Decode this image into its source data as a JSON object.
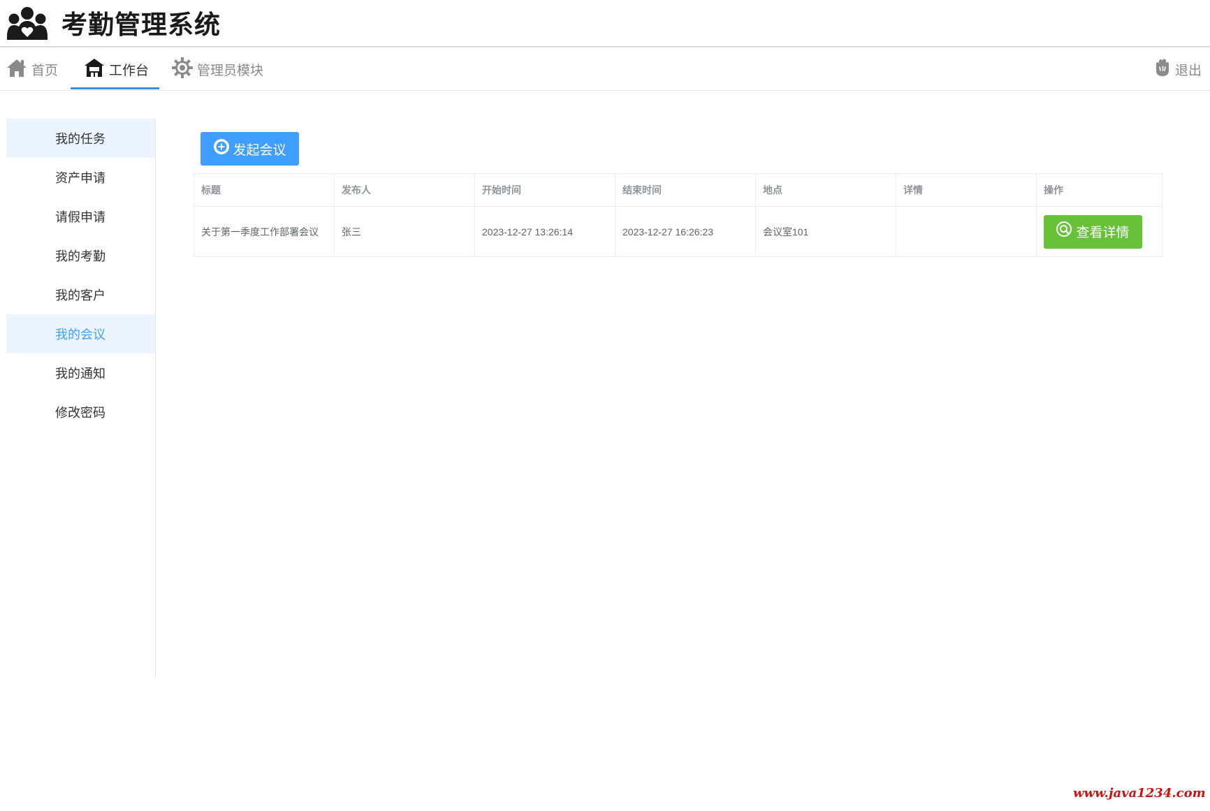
{
  "app": {
    "title": "考勤管理系统",
    "logo_icon": "users-heart-icon"
  },
  "top_nav": {
    "items": [
      {
        "label": "首页",
        "icon": "home-icon"
      },
      {
        "label": "工作台",
        "icon": "workbench-icon",
        "active": true
      },
      {
        "label": "管理员模块",
        "icon": "gear-icon"
      }
    ],
    "logout": {
      "label": "退出",
      "icon": "hand-icon"
    }
  },
  "sidebar": {
    "items": [
      {
        "label": "我的任务"
      },
      {
        "label": "资产申请"
      },
      {
        "label": "请假申请"
      },
      {
        "label": "我的考勤"
      },
      {
        "label": "我的客户"
      },
      {
        "label": "我的会议",
        "active": true
      },
      {
        "label": "我的通知"
      },
      {
        "label": "修改密码"
      }
    ]
  },
  "toolbar": {
    "add_meeting_label": "发起会议",
    "add_icon": "plus-circle-icon"
  },
  "table": {
    "columns": [
      "标题",
      "发布人",
      "开始时间",
      "结束时间",
      "地点",
      "详情",
      "操作"
    ],
    "rows": [
      {
        "title": "关于第一季度工作部署会议",
        "publisher": "张三",
        "start_time": "2023-12-27 13:26:14",
        "end_time": "2023-12-27 16:26:23",
        "location": "会议室101",
        "detail": "",
        "action_label": "查看详情",
        "action_icon": "search-icon"
      }
    ]
  },
  "watermark": "www.java1234.com",
  "colors": {
    "primary": "#409eff",
    "success": "#67c23a",
    "sidebar_active_bg": "#ecf5ff",
    "nav_underline": "#3a8ee6",
    "watermark": "#cc1111"
  }
}
